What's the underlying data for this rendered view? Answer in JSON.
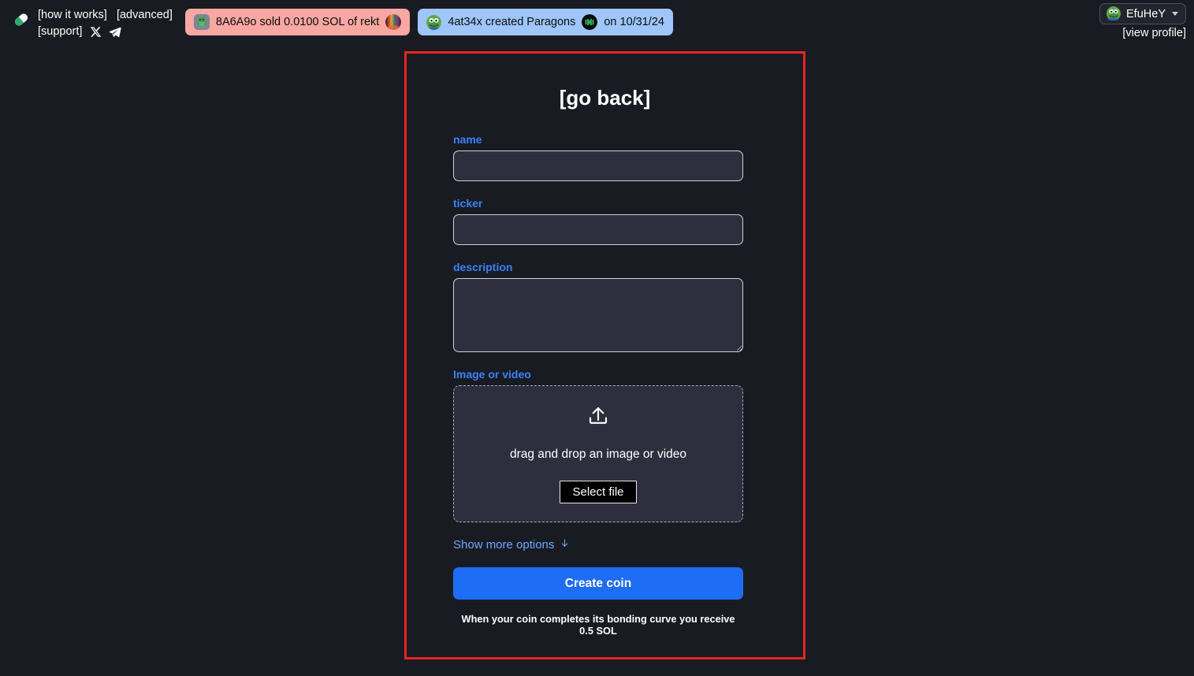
{
  "header": {
    "logo_icon": "pill-capsule-logo",
    "links": [
      {
        "label": "[how it works]",
        "name": "how-it-works"
      },
      {
        "label": "[advanced]",
        "name": "advanced"
      },
      {
        "label": "[support]",
        "name": "support"
      }
    ],
    "social": [
      {
        "icon": "x-twitter-icon",
        "name": "x-twitter-link"
      },
      {
        "icon": "telegram-icon",
        "name": "telegram-link"
      }
    ]
  },
  "banners": [
    {
      "style": "pink",
      "bg": "#f8a7a2",
      "avatar_icon": "user-avatar-pixel-green",
      "text": "8A6A9o  sold 0.0100 SOL of rekt",
      "coin_icon": "coin-rainbow-icon"
    },
    {
      "style": "blue",
      "bg": "#9ec6fb",
      "avatar_icon": "user-avatar-pepe",
      "text_before": "4at34x created Paragons",
      "coin_icon": "coin-paragons-icon",
      "text_after": "on 10/31/24"
    }
  ],
  "profile": {
    "avatar_icon": "user-avatar-pepe",
    "username": "EfuHeY",
    "caret_icon": "chevron-down-icon",
    "view_profile_label": "[view profile]"
  },
  "form": {
    "go_back_label": "[go back]",
    "name": {
      "label": "name",
      "value": "",
      "placeholder": ""
    },
    "ticker": {
      "label": "ticker",
      "value": "",
      "placeholder": ""
    },
    "description": {
      "label": "description",
      "value": "",
      "placeholder": ""
    },
    "media": {
      "label": "Image or video",
      "upload_icon": "upload-icon",
      "drop_text": "drag and drop an image or video",
      "select_file_label": "Select file"
    },
    "show_more_label": "Show more options",
    "show_more_icon": "arrow-down-icon",
    "create_label": "Create coin",
    "bonding_note": "When your coin completes its bonding curve you receive 0.5 SOL"
  },
  "colors": {
    "page_bg": "#191b23",
    "card_border": "#e8261c",
    "label_blue": "#3b82f6",
    "link_blue": "#6ea8fe",
    "primary_button": "#1d6df5",
    "input_bg": "#2f2e3e",
    "banner_pink": "#f8a7a2",
    "banner_blue": "#9ec6fb"
  }
}
